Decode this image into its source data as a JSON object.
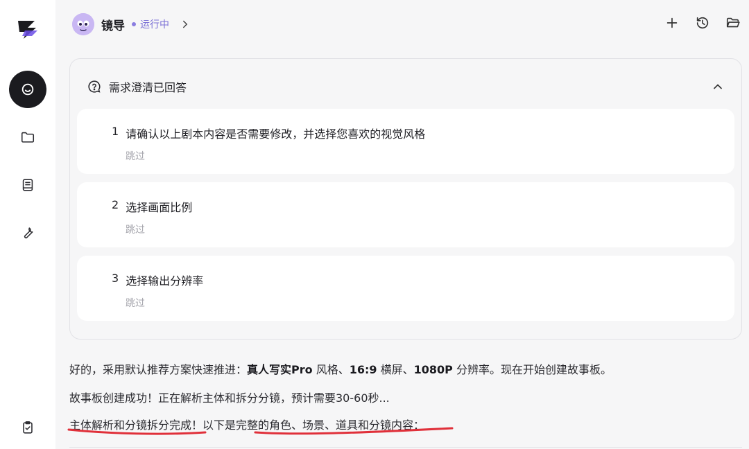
{
  "sidebar": {
    "icons": [
      "logo-icon",
      "chat-icon",
      "folder-icon",
      "book-icon",
      "wrench-icon",
      "clipboard-check-icon"
    ]
  },
  "header": {
    "agent_name": "镜导",
    "status": "运行中",
    "actions": [
      "plus-icon",
      "history-icon",
      "folder-open-icon"
    ]
  },
  "card": {
    "title": "需求澄清已回答",
    "questions": [
      {
        "num": "1",
        "text": "请确认以上剧本内容是否需要修改，并选择您喜欢的视觉风格",
        "skip": "跳过"
      },
      {
        "num": "2",
        "text": "选择画面比例",
        "skip": "跳过"
      },
      {
        "num": "3",
        "text": "选择输出分辨率",
        "skip": "跳过"
      }
    ]
  },
  "messages": {
    "m1_pre": "好的，采用默认推荐方案快速推进：",
    "m1_b1": "真人写实Pro",
    "m1_mid1": " 风格、",
    "m1_b2": "16:9",
    "m1_mid2": " 横屏、",
    "m1_b3": "1080P",
    "m1_post": " 分辨率。现在开始创建故事板。",
    "m2": "故事板创建成功！正在解析主体和拆分分镜，预计需要30-60秒...",
    "m3": "主体解析和分镜拆分完成！以下是完整的角色、场景、道具和分镜内容："
  },
  "colors": {
    "accent": "#7a6fd6",
    "annotation": "#e0303a",
    "active_nav": "#1b1b1f"
  }
}
